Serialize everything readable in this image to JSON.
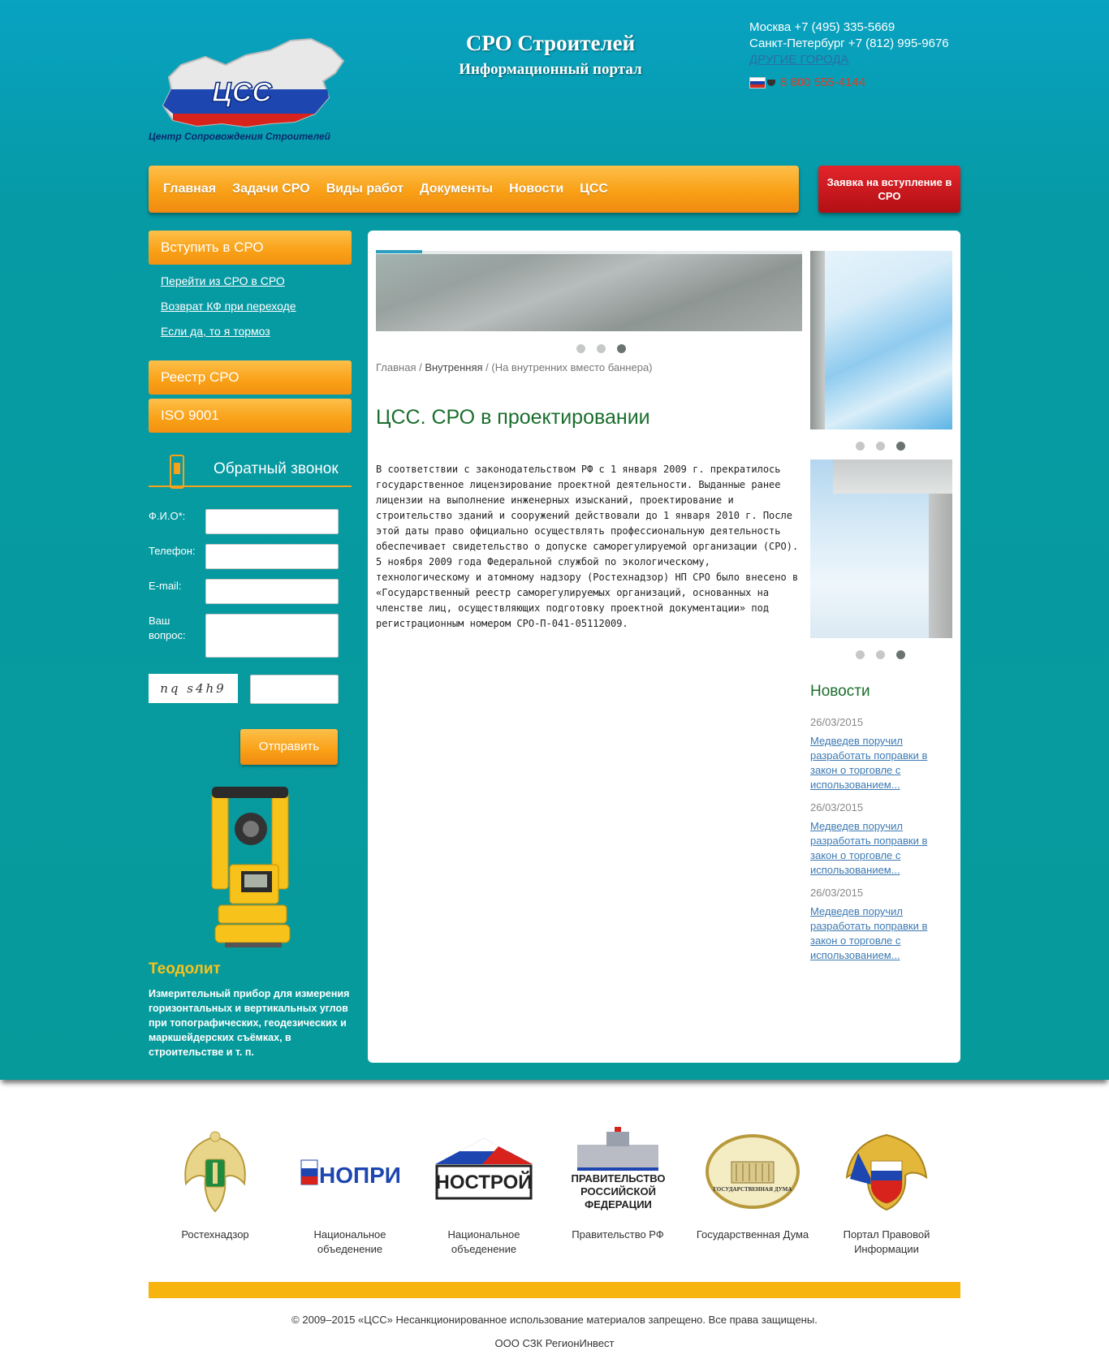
{
  "header": {
    "logo_text": "ЦСС",
    "logo_tagline": "Центр Сопровождения Строителей",
    "site_title": "СРО Строителей",
    "site_subtitle": "Информационный портал",
    "phone_moscow": "Москва +7 (495) 335-5669",
    "phone_spb": "Санкт-Петербург +7 (812) 995-9676",
    "other_cities": "ДРУГИЕ ГОРОДА",
    "hotline": "8 800 555-4144"
  },
  "nav": {
    "items": [
      "Главная",
      "Задачи СРО",
      "Виды работ",
      "Документы",
      "Новости",
      "ЦСС"
    ],
    "apply_button": "Заявка на вступление в СРО"
  },
  "sidebar": {
    "join": "Вступить в СРО",
    "sublinks": [
      "Перейти из СРО в СРО",
      "Возврат КФ при переходе",
      "Если да, то я тормоз"
    ],
    "registry": "Реестр СРО",
    "iso": "ISO 9001",
    "callback_title": "Обратный звонок",
    "form": {
      "fio_label": "Ф.И.О*:",
      "phone_label": "Телефон:",
      "email_label": "E-mail:",
      "question_label": "Ваш вопрос:",
      "captcha_text": "nq s4h9",
      "submit": "Отправить"
    },
    "product_title": "Теодолит",
    "product_text": "Измерительный прибор для измерения горизонтальных и вертикальных углов при топографических, геодезических и маркшейдерских съёмках, в строительстве и т. п."
  },
  "content": {
    "breadcrumb": [
      "Главная",
      "Внутренняя",
      "(На внутренних вместо баннера)"
    ],
    "title": "ЦСС. СРО в проектировании",
    "body": "В соответствии с законодательством РФ с 1 января 2009 г. прекратилось государственное лицензирование проектной деятельности. Выданные ранее лицензии на выполнение инженерных изысканий, проектирование и строительство зданий и сооружений действовали до 1 января 2010 г. После этой даты право официально осуществлять профессиональную деятельность обеспечивает свидетельство о допуске саморегулируемой организации (СРО). 5 ноября 2009 года Федеральной службой по экологическому, технологическому и атомному надзору (Ростехнадзор) НП СРО было внесено в «Государственный реестр саморегулируемых организаций, основанных на членстве лиц, осуществляющих подготовку проектной документации» под регистрационным номером СРО-П-041-05112009."
  },
  "news": {
    "title": "Новости",
    "items": [
      {
        "date": "26/03/2015",
        "text": "Медведев поручил разработать поправки в закон о торговле с использованием..."
      },
      {
        "date": "26/03/2015",
        "text": "Медведев поручил разработать поправки в закон о торговле с использованием..."
      },
      {
        "date": "26/03/2015",
        "text": "Медведев поручил разработать поправки в закон о торговле с использованием..."
      }
    ]
  },
  "partners": [
    {
      "caption": "Ростехнадзор",
      "icon": "rostekhnadzor-emblem"
    },
    {
      "caption": "Национальное объеденение",
      "icon": "nopriz-logo",
      "logo_text": "НОПРИЗ"
    },
    {
      "caption": "Национальное объеденение",
      "icon": "nostroy-logo",
      "logo_text": "НОСТРОЙ"
    },
    {
      "caption": "Правительство РФ",
      "icon": "government-logo",
      "logo_text": "ПРАВИТЕЛЬСТВО РОССИЙСКОЙ ФЕДЕРАЦИИ"
    },
    {
      "caption": "Государственная Дума",
      "icon": "duma-logo",
      "logo_text": "ГОСУДАРСТВЕННАЯ ДУМА"
    },
    {
      "caption": "Портал Правовой Информации",
      "icon": "legal-portal-emblem"
    }
  ],
  "footer": {
    "copyright": "© 2009–2015 «ЦСС» Несанкционированное использование материалов запрещено. Все права защищены.",
    "company": "ООО СЗК РегионИнвест"
  },
  "colors": {
    "header_bg": "#08a2c2",
    "body_bg": "#079a9b",
    "orange_accent": "#f9a016",
    "red_button": "#c8171c",
    "title_green": "#1a6e2c",
    "link_blue": "#3d7ab3",
    "footer_bar": "#f7b40f"
  }
}
